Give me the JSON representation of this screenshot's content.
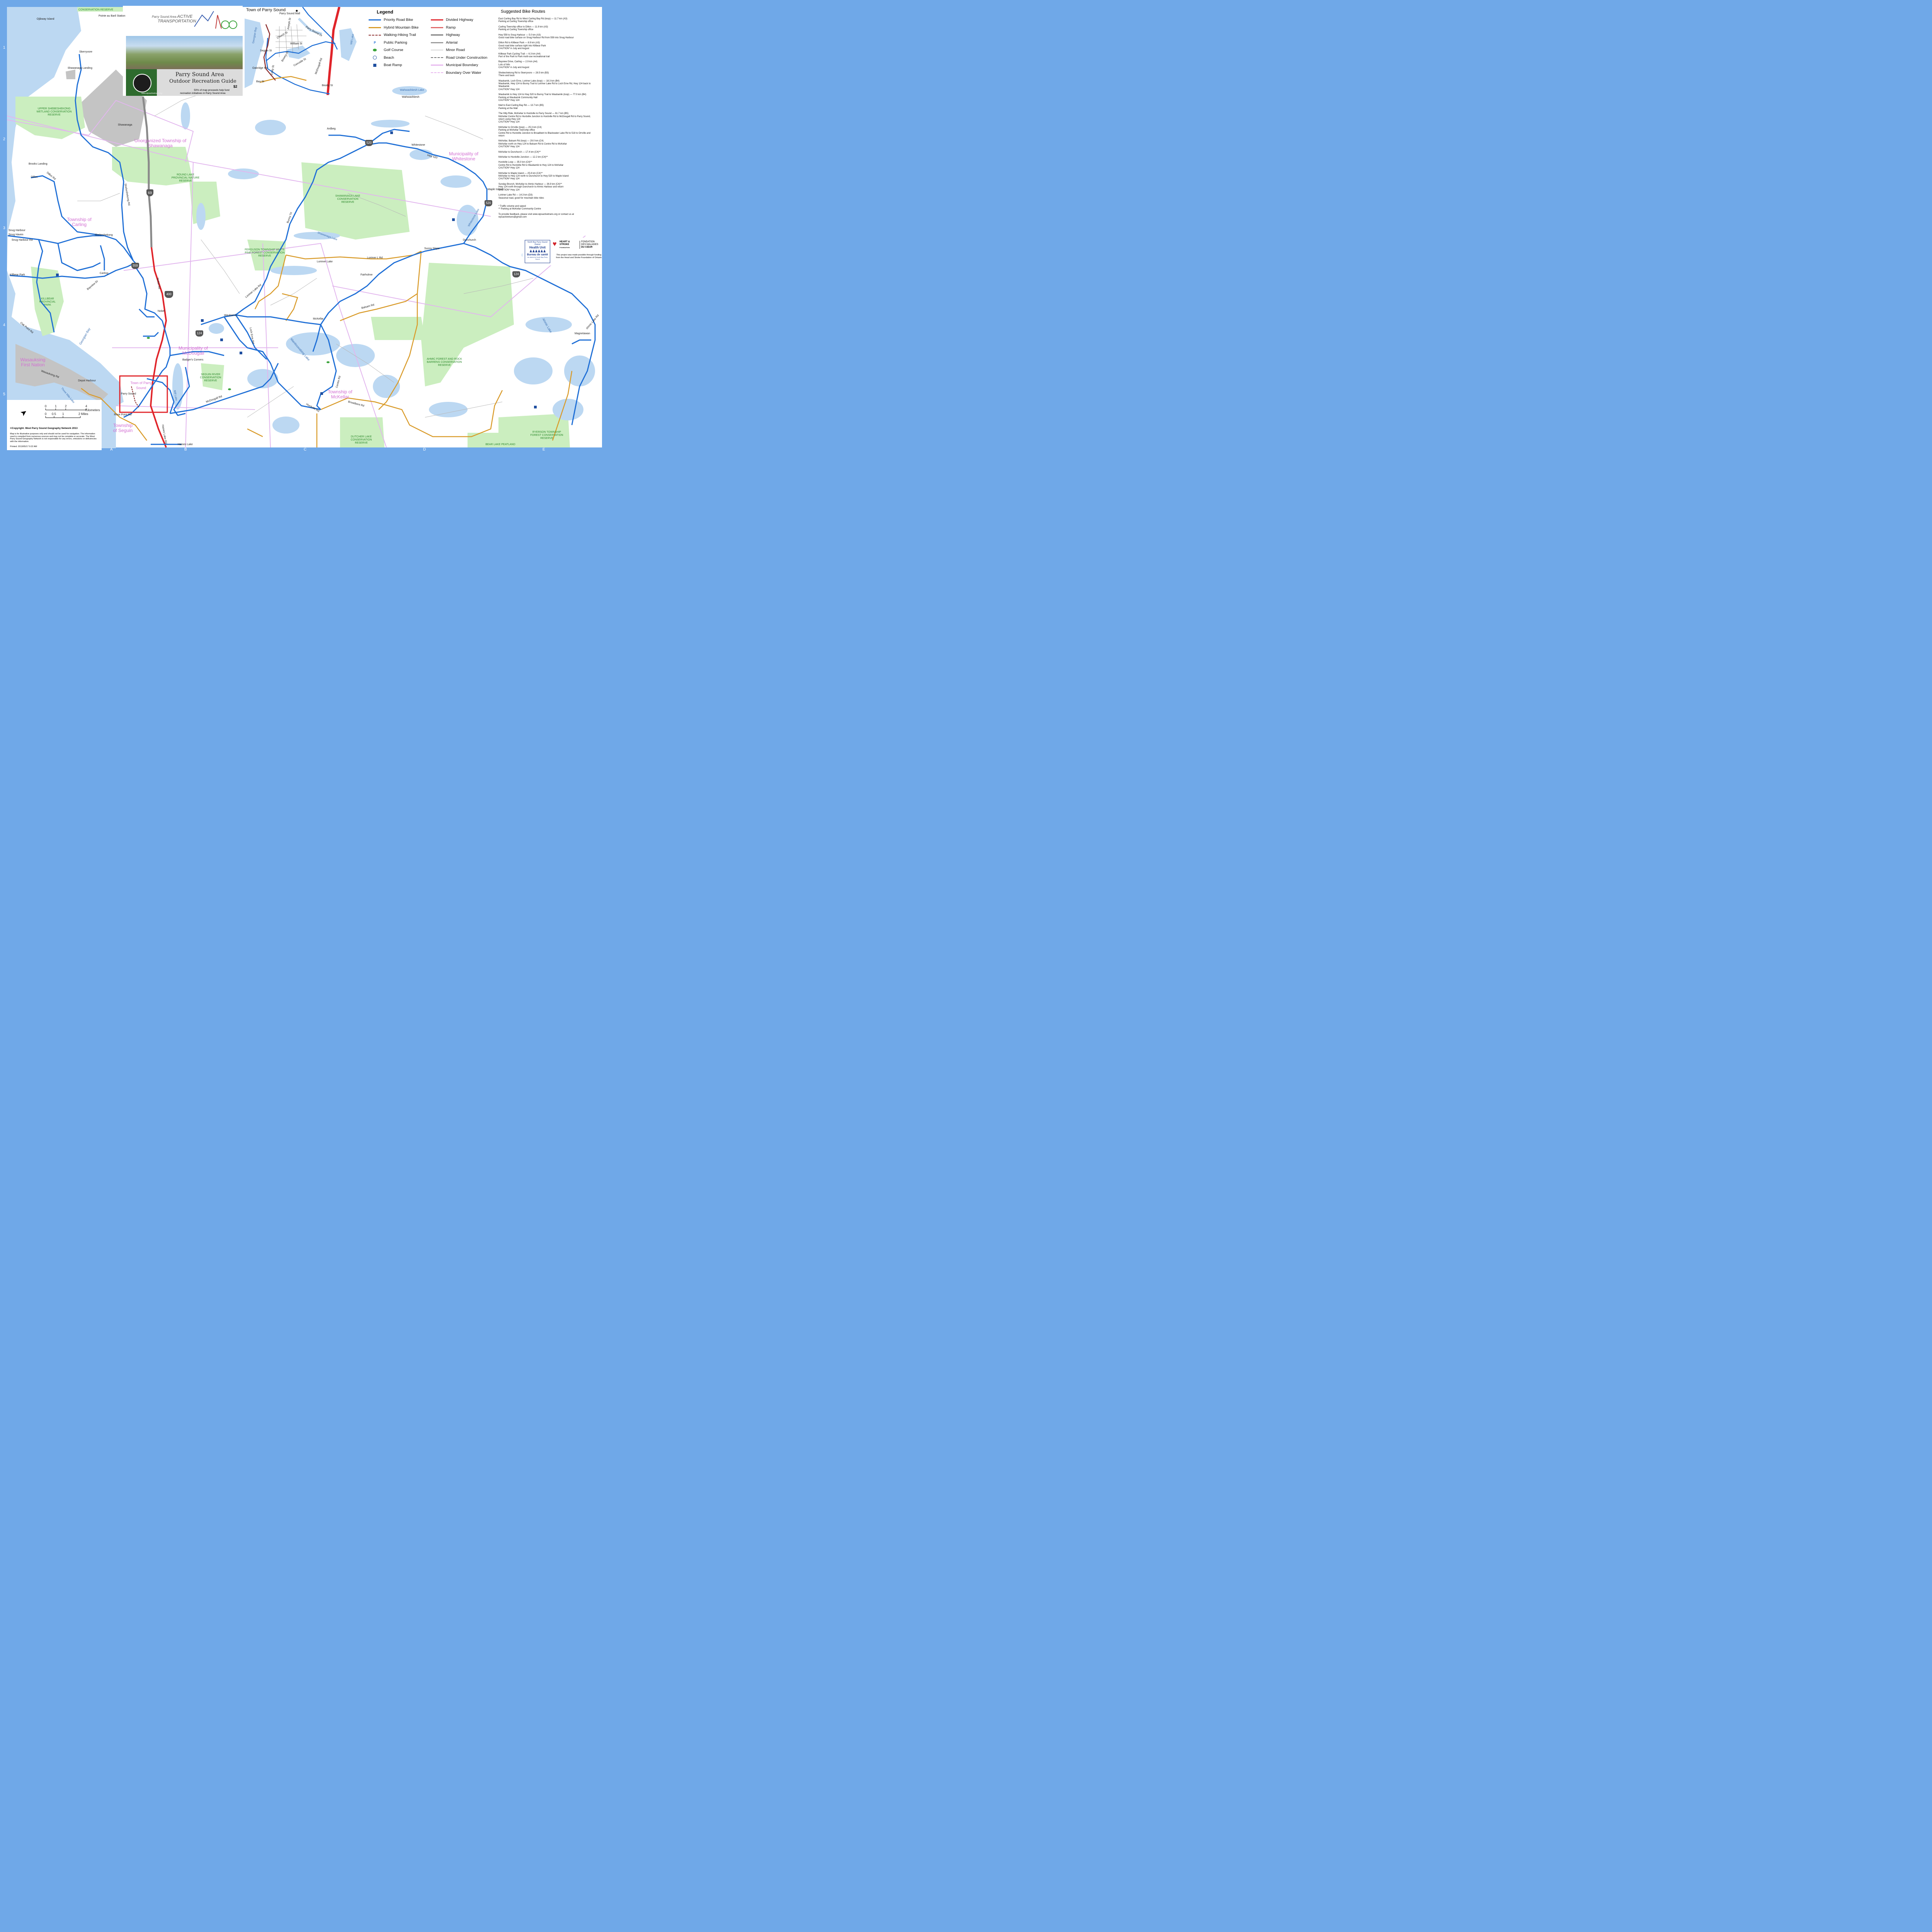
{
  "cover": {
    "brand_line1": "Parry Sound Area",
    "brand_line2": "ACTIVE",
    "brand_line3": "TRANSPORTATION",
    "title_line1": "Parry Sound Area",
    "title_line2": "Outdoor Recreation Guide",
    "price": "$2",
    "note_line1": "50% of map proceeds help fund",
    "note_line2": "recreation initiatives in Parry Sound Area",
    "url": "www.wpsactivetrans.org"
  },
  "town_inset": {
    "title": "Town of Parry Sound",
    "labels": [
      "Parry Sound Mall",
      "Georgian Bay",
      "William St",
      "Church St",
      "Mill Lake",
      "Bowes St",
      "Oakridge Rd",
      "McDougall Rd",
      "Parry Sound Dr",
      "Joseph St",
      "Seguin St",
      "Emily St",
      "Bay St",
      "Cascade St",
      "Beatty St"
    ]
  },
  "legend": {
    "title": "Legend",
    "items": [
      {
        "label": "Priority Road Bike",
        "sym": "line",
        "color": "#1f6fd6"
      },
      {
        "label": "Divided Highway",
        "sym": "line",
        "color": "#e0242a"
      },
      {
        "label": "Hybrid Mountain Bike",
        "sym": "line",
        "color": "#d99b2a"
      },
      {
        "label": "Ramp",
        "sym": "line",
        "color": "#e06a6a"
      },
      {
        "label": "Walking-Hiking Trail",
        "sym": "dash",
        "color": "#8b2a2a"
      },
      {
        "label": "Highway",
        "sym": "line",
        "color": "#7a7a7a"
      },
      {
        "label": "Public Parking",
        "sym": "P",
        "color": "#1f6fd6"
      },
      {
        "label": "Arterial",
        "sym": "line",
        "color": "#9a9a9a"
      },
      {
        "label": "Golf Course",
        "sym": "golf",
        "color": "#3aa33a"
      },
      {
        "label": "Minor Road",
        "sym": "thin",
        "color": "#aaaaaa"
      },
      {
        "label": "Beach",
        "sym": "beach",
        "color": "#1f4fa0"
      },
      {
        "label": "Road Under Construction",
        "sym": "dash",
        "color": "#777777"
      },
      {
        "label": "Boat Ramp",
        "sym": "boat",
        "color": "#1f4fa0"
      },
      {
        "label": "Municipal Boundary",
        "sym": "line",
        "color": "#e7b6ef"
      },
      {
        "label": "",
        "sym": "none",
        "color": "#ffffff"
      },
      {
        "label": "Boundary Over Water",
        "sym": "dash",
        "color": "#e7b6ef"
      }
    ]
  },
  "routes": {
    "title": "Suggested Bike Routes",
    "items": [
      {
        "line1": "East Carling Bay Rd to West Carling Bay Rd (loop) — 11.7 km (A3)",
        "line2": "Parking at Carling Township office"
      },
      {
        "line1": "Carling Township office to Dillon — 11.9 km (A3)",
        "line2": "Parking at Carling Township office"
      },
      {
        "line1": "Hwy 559 to Snug Harbour — 5.0 km (A3)",
        "line2": "Good road bike surface on Snug Harbour Rd from 559 into Snug Harbour"
      },
      {
        "line1": "Dillon Rd to Killbear Park — 8.9 km (A3)",
        "line2": "Good road bike surface right into Killbear Park\nCAUTION* in July and August"
      },
      {
        "line1": "Killbear Park Cycling Trail — 6.3 km (A4)",
        "line2": "Part of the Park to Park multi-use recreational trail"
      },
      {
        "line1": "Bayview Drive, Carling — 2.9 km (A4)",
        "line2": "Lots of hills\nCAUTION* in July and August"
      },
      {
        "line1": "Shebeshekong Rd to Skerryvore — 28.5 km (B3)",
        "line2": "There and back"
      },
      {
        "line1": "Waubamik, Loch Erne, Lorimer Lake (loop) — 18.3 km (B4)",
        "line2": "Waubamik, Hwy 124 to Bunny Trail to Lorimer Lake Rd to Loch Erne Rd, Hwy 124 back to Waubamik\nCAUTION* Hwy 124"
      },
      {
        "line1": "Waubamik to Hwy 124 to Hwy 520 to Bunny Trail to Waubamik (loop) — 77.0 km (B4)",
        "line2": "Parking at Waubamik Community Hall\nCAUTION* Hwy 124"
      },
      {
        "line1": "Mall to East Carling Bay Rd — 13.7 km (B5)",
        "line2": "Parking at the Mall"
      },
      {
        "line1": "The Hilly Ride, McKellar to Hurdville to Parry Sound — 61.7 km (B5)",
        "line2": "McKellar Centre Rd to Hurdville Junction to Hurdville Rd to McDougall Rd to Parry Sound, return using Hwy 124\nCAUTION* Hwy 124"
      },
      {
        "line1": "McKellar to Orrville (loop) — 25.3 km (C4)",
        "line2": "Parking at McKellar Township office\nCentre Rd to Hurdville Junction to Broadbent to Blackwater Lake Rd to 518 to Orrville and return"
      },
      {
        "line1": "McKellar, Balsam Rd (loop) — 29.0 km (C4)",
        "line2": "McKellar north on Hwy 124 to Balsam Rd to Centre Rd to McKellar\nCAUTION* Hwy 124"
      },
      {
        "line1": "McKellar to Dunchurch — 17.4 km (C4)**",
        "line2": ""
      },
      {
        "line1": "McKellar to Hurdville Junction — 12.2 km (C4)**",
        "line2": ""
      },
      {
        "line1": "Hurdville Loop — 35.0 km (C4)**",
        "line2": "Centre Rd to Hurdville Rd to Waubamik to Hwy 124 to McKellar\nCAUTION* Hwy 124"
      },
      {
        "line1": "McKellar to Maple Island — 25.8 km (C4)**",
        "line2": "McKellar to Hwy 124 north to Dunchurch to Hwy 520 to Maple Island\nCAUTION* Hwy 124"
      },
      {
        "line1": "Sunday Brunch, McKellar to Ahmic Harbour — 36.9 km (C4)**",
        "line2": "Hwy 124 north through Dunchurch to Ahmic Harbour and return\nCAUTION* Hwy 124"
      },
      {
        "line1": "Lorimer Lake Rd — 14.3 km (D3)",
        "line2": "Seasonal road, good for mountain bike rides"
      }
    ],
    "footnote1": "* Traffic volume and speed",
    "footnote2": "** Parking at McKellar Community Centre",
    "feedback": "To provide feedback, please visit www.wpsactivetrans.org or contact us at wpsactivetrans@gmail.com"
  },
  "partners": {
    "hu_top": "North Bay Parry Sound District",
    "hu_name": "Health Unit",
    "hu_fr": "Bureau de santé",
    "hu_fr_sub": "du district de North Bay-Parry Sound",
    "hs_name1": "HEART &",
    "hs_name2": "STROKE",
    "hs_name3": "FOUNDATION",
    "hs_fr1": "FONDATION",
    "hs_fr2": "DES MALADIES",
    "hs_fr3": "DU CŒUR",
    "funding": "This project was made possible through funding from the Heart and Stroke Foundation of Ontario"
  },
  "scale": {
    "km_ticks": [
      "0",
      "1",
      "2",
      "4 Kilometers"
    ],
    "mi_ticks": [
      "0",
      "0.5",
      "1",
      "2 Miles"
    ],
    "copyright": "©Copyright. West Parry Sound Geography Network 2013",
    "disclaimer": "Map is for illustrative purposes only and should not be used for navigation. The information used is compiled from numerous sources and may not be complete or accurate. The West Parry Sound Geography Network is not responsible for any errors, omissions or deficiencies with the information.",
    "printed": "Printed: 2013/05/17 9:22 AM"
  },
  "grid": {
    "letters": [
      "A",
      "B",
      "C",
      "D",
      "E"
    ],
    "numbers": [
      "1",
      "2",
      "3",
      "4",
      "5"
    ]
  },
  "places": [
    "Ojibway Island",
    "Pointe au Baril Station",
    "Skerryvore",
    "Shawanaga Landing",
    "Shawanaga",
    "Brooks Landing",
    "Dillon",
    "Snug Harbour",
    "Snug Haven",
    "Shebeshekong",
    "Killbear Park",
    "Carling",
    "Nobel",
    "Waubamik",
    "McKellar",
    "Ardbeg",
    "Whitestone",
    "Wahwashkesh",
    "Dunchurch",
    "Sunny Slope",
    "Fairholme",
    "Lorimer Lake",
    "Magnetawan",
    "Badger's Corners",
    "Depot Harbour",
    "Parry Sound",
    "Haines Lake",
    "Maple Island"
  ],
  "townships": [
    "Unorganized Township of Shawanaga",
    "Township of Carling",
    "Municipality of Whitestone",
    "Municipality of McDougall",
    "Township of McKellar",
    "Township of Seguin",
    "Wasauksing First Nation",
    "Town of Parry Sound"
  ],
  "reserves": [
    "CONSERVATION RESERVE",
    "UPPER SHEBESHEKONG WETLAND CONSERVATION RESERVE",
    "ROUND LAKE PROVINCIAL NATURE RESERVE",
    "SHAWANAGA LAKE CONSERVATION RESERVE",
    "FERGUSON TOWNSHIP WHITE PINE FOREST CONSERVATION RESERVE",
    "KILLBEAR PROVINCIAL PARK",
    "SEGUIN RIVER CONSERVATION RESERVE",
    "AHMIC FOREST AND ROCK BARRENS CONSERVATION RESERVE",
    "DUTCHER LAKE CONSERVATION RESERVE",
    "RYERSON TOWNSHIP FOREST CONSERVATION RESERVE",
    "BEAR LAKE PEATLAND"
  ],
  "waters": [
    "Georgian Bay",
    "Manitouwabing Lake",
    "Ahmic Lake",
    "Wahwashkesh Lake",
    "Whitestone Lake",
    "Shawanaga Lake",
    "Three Mile Lake",
    "Mill Lake"
  ],
  "highway_shields": [
    "69",
    "400",
    "559",
    "124",
    "520"
  ],
  "roads": [
    "Dillon Rd",
    "Snug Harbour Rd",
    "Shebeshekong Rd",
    "Nobel Rd",
    "Lorimer Lake Rd",
    "Balsam Rd",
    "Centre Rd",
    "Broadbent Rd",
    "Hurdville Rd",
    "McDougall Rd",
    "Oak Point Rd",
    "Rose Point Rd",
    "Bayview Dr",
    "Bunny Trl",
    "Loch Erne Rd",
    "Haines Lake Rd",
    "Ahmic Lake Rd",
    "Wasauksing Rd",
    "Hwy 520",
    "Lorimer L Rd"
  ]
}
